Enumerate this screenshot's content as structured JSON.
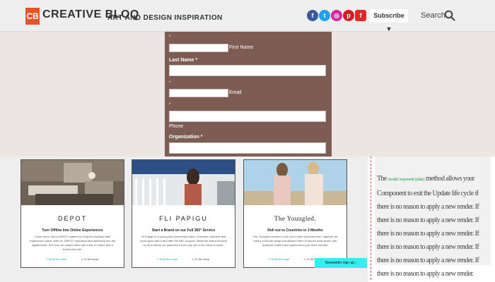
{
  "header": {
    "logo_badge": "CB",
    "logo_text": "CREATIVE BLOQ",
    "tagline": "ART AND DESIGN INSPIRATION",
    "social": [
      {
        "icon": "facebook-icon",
        "glyph": "f",
        "color": "#3b5998"
      },
      {
        "icon": "twitter-icon",
        "glyph": "t",
        "color": "#1da1f2"
      },
      {
        "icon": "instagram-icon",
        "glyph": "◎",
        "color": "#d6249f"
      },
      {
        "icon": "pinterest-icon",
        "glyph": "p",
        "color": "#cb2027"
      },
      {
        "icon": "flipboard-icon",
        "glyph": "f",
        "color": "#e12828"
      }
    ],
    "subscribe_label": "Subscribe ▼",
    "search_label": "Search"
  },
  "form": {
    "required_mark": "*",
    "first_name_label": "First Name",
    "last_name_label": "Last Name *",
    "email_label": "Email",
    "phone_label": "Phone",
    "organization_label": "Organization *"
  },
  "cards": [
    {
      "brand": "DEPOT",
      "heading": "Turn Offline Into Online Experiences",
      "text": "Home decor brand DEPOT wanted to bring its inspiring retail experience online. With us, DEPOT replicated that ambiance into the digital world. See how we helped them with Click & Collect and a brand new site.",
      "link1": "↗ Read the case",
      "link2": "↘ To the shop"
    },
    {
      "brand": "FLI PAPIGU",
      "heading": "Start a Brand on our Full 360° Service",
      "text": "Fli Papigu is a young and pioneering brand. It needed a partner that could grow with it and offer full 360° support. While the brand focused on its products we launched it from day one to be ready to scale.",
      "link1": "↗ Read the case",
      "link2": "↘ To the shop"
    },
    {
      "brand": "The Youngled.",
      "heading": "Roll out to Countries in 3 Months",
      "text": "The Youngled needed to roll out to more countries fast. Together we built a multi-site setup that allowed them to launch local stores with localized content and payments in just three months.",
      "link1": "↗ Read the case",
      "link2": "↘ To the shop"
    }
  ],
  "aside": {
    "text_before": "The",
    "highlight": "shouldComponentUpdate()",
    "text_after": "method allows your Component to exit the Update life cycle if there is no reason to apply a new render. If there is no reason to apply a new render. If there is no reason to apply a new render. If there is no reason to apply a new render. If there is no reason to apply a new render. If there is no reason to apply a new render."
  },
  "newsletter_label": "Newsletter sign up ›"
}
